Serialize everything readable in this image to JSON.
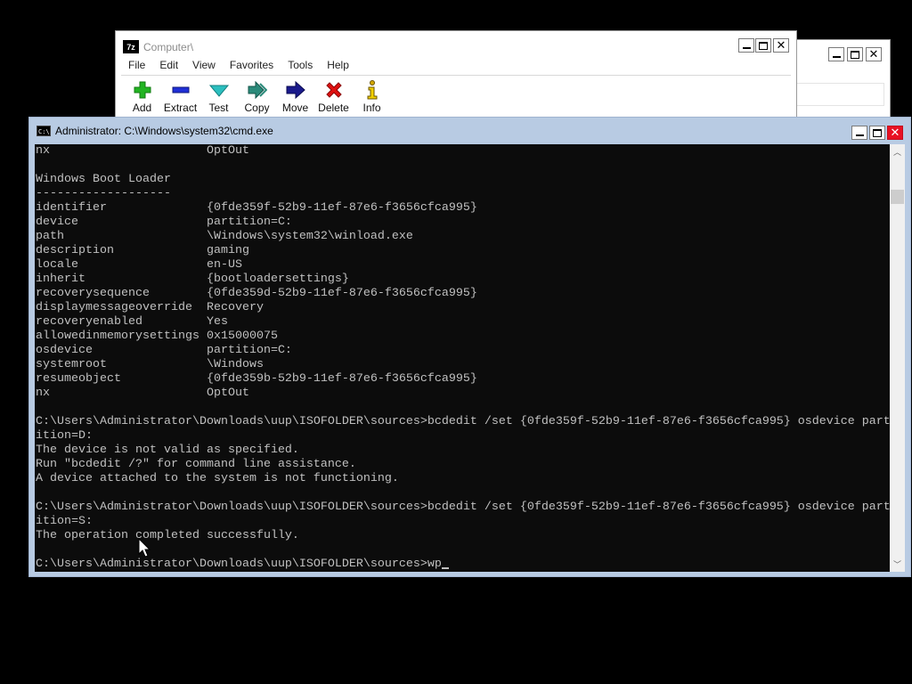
{
  "background_window": {
    "buttons": [
      "minimize",
      "maximize",
      "close"
    ]
  },
  "sevenzip": {
    "title": "Computer\\",
    "icon_text": "7z",
    "menu": [
      "File",
      "Edit",
      "View",
      "Favorites",
      "Tools",
      "Help"
    ],
    "toolbar": [
      {
        "label": "Add",
        "icon": "plus-icon",
        "color": "#22b422"
      },
      {
        "label": "Extract",
        "icon": "minus-icon",
        "color": "#1f2fd6"
      },
      {
        "label": "Test",
        "icon": "check-icon",
        "color": "#2bbfbf"
      },
      {
        "label": "Copy",
        "icon": "double-arrow-right-icon",
        "color": "#2b8a7a"
      },
      {
        "label": "Move",
        "icon": "arrow-right-icon",
        "color": "#1a1a8c"
      },
      {
        "label": "Delete",
        "icon": "x-icon",
        "color": "#e01010"
      },
      {
        "label": "Info",
        "icon": "info-icon",
        "color": "#d4a800"
      }
    ]
  },
  "cmd": {
    "title": "Administrator: C:\\Windows\\system32\\cmd.exe",
    "icon_text": "C:\\",
    "lines": [
      "nx                      OptOut",
      "",
      "Windows Boot Loader",
      "-------------------",
      "identifier              {0fde359f-52b9-11ef-87e6-f3656cfca995}",
      "device                  partition=C:",
      "path                    \\Windows\\system32\\winload.exe",
      "description             gaming",
      "locale                  en-US",
      "inherit                 {bootloadersettings}",
      "recoverysequence        {0fde359d-52b9-11ef-87e6-f3656cfca995}",
      "displaymessageoverride  Recovery",
      "recoveryenabled         Yes",
      "allowedinmemorysettings 0x15000075",
      "osdevice                partition=C:",
      "systemroot              \\Windows",
      "resumeobject            {0fde359b-52b9-11ef-87e6-f3656cfca995}",
      "nx                      OptOut",
      "",
      "C:\\Users\\Administrator\\Downloads\\uup\\ISOFOLDER\\sources>bcdedit /set {0fde359f-52b9-11ef-87e6-f3656cfca995} osdevice part",
      "ition=D:",
      "The device is not valid as specified.",
      "Run \"bcdedit /?\" for command line assistance.",
      "A device attached to the system is not functioning.",
      "",
      "C:\\Users\\Administrator\\Downloads\\uup\\ISOFOLDER\\sources>bcdedit /set {0fde359f-52b9-11ef-87e6-f3656cfca995} osdevice part",
      "ition=S:",
      "The operation completed successfully.",
      "",
      "C:\\Users\\Administrator\\Downloads\\uup\\ISOFOLDER\\sources>wp"
    ],
    "console_bg": "#0c0c0c",
    "console_fg": "#c0c0c0"
  }
}
